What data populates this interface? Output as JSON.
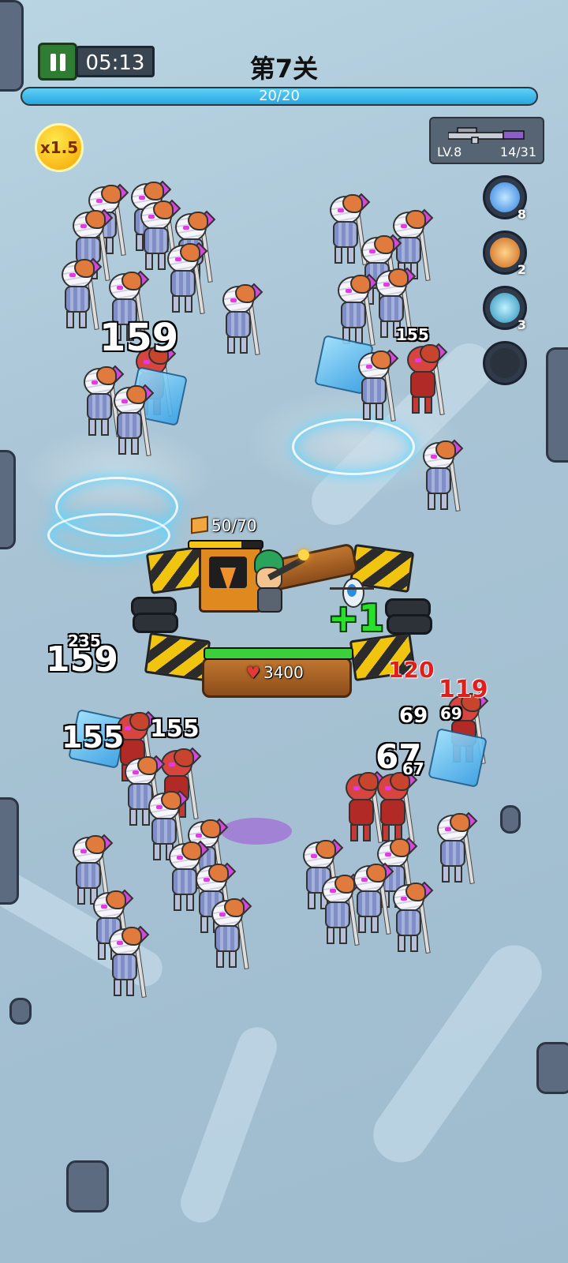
{
  "hud": {
    "timer": "05:13",
    "level_title": "第7关",
    "wave_progress_text": "20/20",
    "wave_progress_fraction": 1.0,
    "speed_multiplier": "x1.5"
  },
  "weapon": {
    "level": "LV.8",
    "ammo": "14/31",
    "icon": "assault-rifle-icon"
  },
  "skills": [
    {
      "icon": "lightning-icon",
      "count": "8",
      "color": "#3b8ff0"
    },
    {
      "icon": "rocket-icon",
      "count": "2",
      "color": "#e58a2a"
    },
    {
      "icon": "missile-icon",
      "count": "3",
      "color": "#4bc1e8"
    },
    {
      "icon": "empty-slot-icon",
      "count": "",
      "color": "#2a333d"
    }
  ],
  "base": {
    "resource": "50/70",
    "resource_fraction": 0.714,
    "hp": "3400",
    "hp_fraction": 1.0
  },
  "combat_text": {
    "d1": "159",
    "d2": "155",
    "d3": "159",
    "d4": "155",
    "d5": "155",
    "d6": "120",
    "d7": "119",
    "d8": "67",
    "d9": "69",
    "d10": "+1",
    "d11": "235",
    "d12": "67",
    "d13": "69"
  },
  "colors": {
    "accent_progress": "#27a7e0",
    "hp_bar": "#3ccf3c",
    "resource_bar": "#f5c518",
    "enemy_gem": "#d04bd6"
  }
}
